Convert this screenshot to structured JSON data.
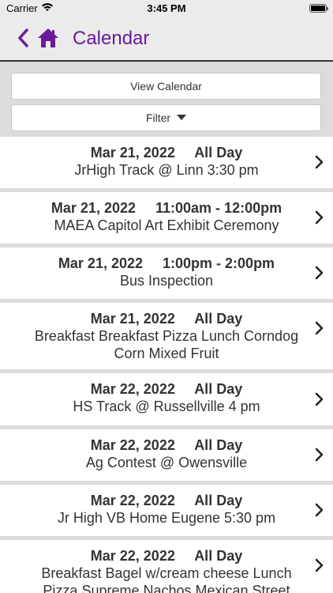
{
  "status_bar": {
    "carrier": "Carrier",
    "time": "3:45 PM"
  },
  "nav": {
    "title": "Calendar",
    "back_icon": "chevron-left-icon",
    "home_icon": "home-icon",
    "accent_color": "#6a1b9a"
  },
  "controls": {
    "view_calendar": "View Calendar",
    "filter": "Filter"
  },
  "events": [
    {
      "date": "Mar 21, 2022",
      "time": "All Day",
      "title": "JrHigh Track @ Linn 3:30 pm"
    },
    {
      "date": "Mar 21, 2022",
      "time": "11:00am - 12:00pm",
      "title": "MAEA Capitol Art Exhibit Ceremony"
    },
    {
      "date": "Mar 21, 2022",
      "time": "1:00pm - 2:00pm",
      "title": "Bus Inspection"
    },
    {
      "date": "Mar 21, 2022",
      "time": "All Day",
      "title": "Breakfast Breakfast Pizza Lunch Corndog Corn Mixed Fruit"
    },
    {
      "date": "Mar 22, 2022",
      "time": "All Day",
      "title": "HS Track @ Russellville 4 pm"
    },
    {
      "date": "Mar 22, 2022",
      "time": "All Day",
      "title": "Ag Contest @ Owensville"
    },
    {
      "date": "Mar 22, 2022",
      "time": "All Day",
      "title": "Jr High VB Home Eugene 5:30 pm"
    },
    {
      "date": "Mar 22, 2022",
      "time": "All Day",
      "title": "Breakfast Bagel w/cream cheese Lunch Pizza Supreme Nachos Mexican Street"
    }
  ]
}
